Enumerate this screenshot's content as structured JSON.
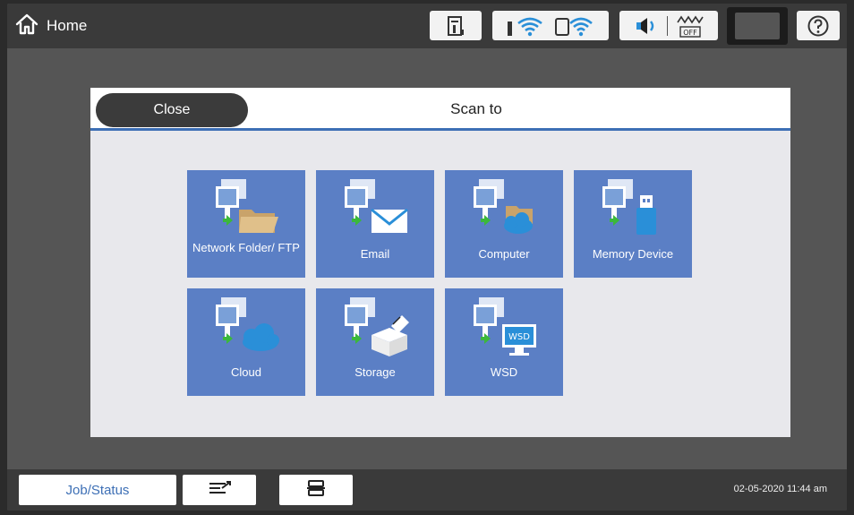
{
  "topbar": {
    "home_label": "Home",
    "icons": [
      "ink-status-icon",
      "wifi-icon",
      "wifi-direct-icon",
      "sound-icon",
      "eco-mode-off-icon",
      "sleep-icon",
      "help-icon"
    ]
  },
  "dialog": {
    "close_label": "Close",
    "title": "Scan to"
  },
  "tiles": [
    {
      "label": "Network Folder/ FTP",
      "icon": "network-folder-icon"
    },
    {
      "label": "Email",
      "icon": "email-icon"
    },
    {
      "label": "Computer",
      "icon": "computer-icon"
    },
    {
      "label": "Memory Device",
      "icon": "memory-device-icon"
    },
    {
      "label": "Cloud",
      "icon": "cloud-icon"
    },
    {
      "label": "Storage",
      "icon": "storage-icon"
    },
    {
      "label": "WSD",
      "icon": "wsd-icon",
      "badge": "WSD"
    }
  ],
  "bottombar": {
    "job_status_label": "Job/Status",
    "datetime": "02-05-2020 11:44 am"
  },
  "colors": {
    "tile": "#5b7fc5",
    "accent": "#3d6fb5",
    "background": "#555555"
  }
}
